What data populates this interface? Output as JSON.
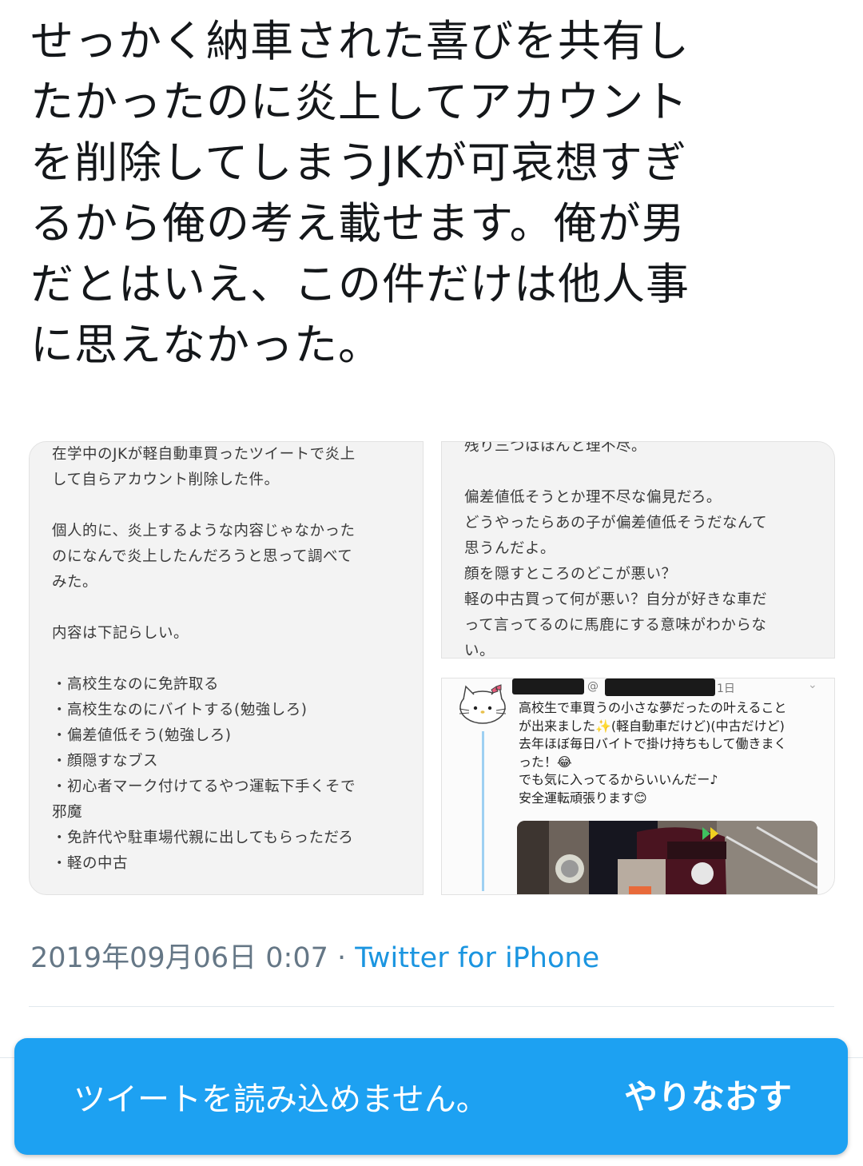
{
  "tweet": {
    "text": "せっかく納車された喜びを共有し\nたかったのに炎上してアカウント\nを削除してしまうJKが可哀想すぎ\nるから俺の考え載せます。俺が男\nだとはいえ、この件だけは他人事\nに思えなかった。",
    "timestamp": "2019年09月06日 0:07",
    "separator": "·",
    "source": "Twitter for iPhone"
  },
  "media": {
    "left_note": "在学中のJKが軽自動車買ったツイートで炎上\nして自らアカウント削除した件。\n\n個人的に、炎上するような内容じゃなかった\nのになんで炎上したんだろうと思って調べて\nみた。\n\n内容は下記らしい。\n\n・高校生なのに免許取る\n・高校生なのにバイトする(勉強しろ)\n・偏差値低そう(勉強しろ)\n・顔隠すなブス\n・初心者マーク付けてるやつ運転下手くそで\n邪魔\n・免許代や駐車場代親に出してもらっただろ\n・軽の中古",
    "top_right_note": "残り三つはほんと理不尽。\n\n偏差値低そうとか理不尽な偏見だろ。\nどうやったらあの子が偏差値低そうだなんて\n思うんだよ。\n顔を隠すところのどこが悪い？\n軽の中古買って何が悪い？自分が好きな車だ\nって言ってるのに馬鹿にする意味がわからな\nい。",
    "embedded": {
      "handle_prefix": "@",
      "date_fragment": "1日",
      "caret": "⌄",
      "text": "高校生で車買うの小さな夢だったの叶えること\nが出来ました✨(軽自動車だけど)(中古だけど)\n去年ほぼ毎日バイトで掛け持ちもして働きまく\nった！😂\nでも気に入ってるからいいんだー♪\n安全運転頑張ります😊"
    }
  },
  "error_bar": {
    "message": "ツイートを読み込めません。",
    "retry_label": "やりなおす"
  },
  "colors": {
    "text": "#14171a",
    "meta": "#657786",
    "link": "#1b95e0",
    "error_bg": "#1da1f2"
  }
}
